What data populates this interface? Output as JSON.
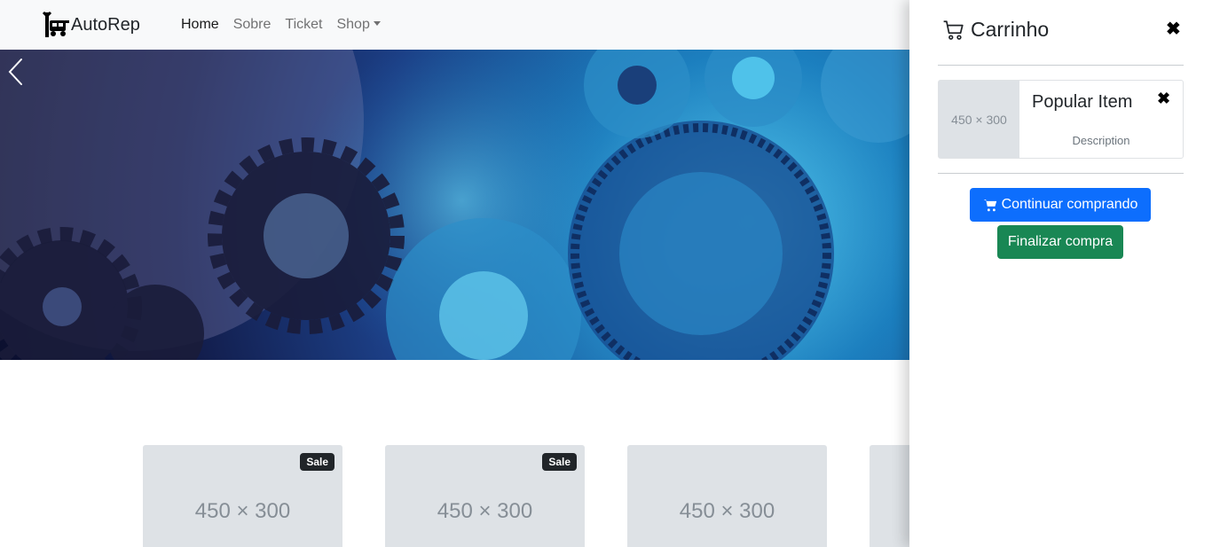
{
  "navbar": {
    "brand": "AutoRep",
    "brand_icon": "car-repair-icon",
    "links": [
      {
        "label": "Home",
        "active": true
      },
      {
        "label": "Sobre",
        "active": false
      },
      {
        "label": "Ticket",
        "active": false
      },
      {
        "label": "Shop",
        "active": false,
        "dropdown": true
      }
    ]
  },
  "carousel": {
    "image": "blue gears banner",
    "prev_icon": "chevron-left-icon"
  },
  "products": [
    {
      "placeholder": "450 × 300",
      "badge": "Sale"
    },
    {
      "placeholder": "450 × 300",
      "badge": "Sale"
    },
    {
      "placeholder": "450 × 300",
      "badge": ""
    },
    {
      "placeholder": "",
      "badge": ""
    }
  ],
  "cart": {
    "title": "Carrinho",
    "title_icon": "cart-icon",
    "close_label": "✖",
    "items": [
      {
        "placeholder": "450 × 300",
        "name": "Popular Item",
        "description": "Description",
        "remove_label": "✖"
      }
    ],
    "continue_label": "Continuar comprando",
    "continue_icon": "cart-icon",
    "checkout_label": "Finalizar compra"
  },
  "colors": {
    "primary": "#0d6efd",
    "success": "#198754",
    "dark": "#212529",
    "navbar_bg": "#f8f9fa"
  }
}
